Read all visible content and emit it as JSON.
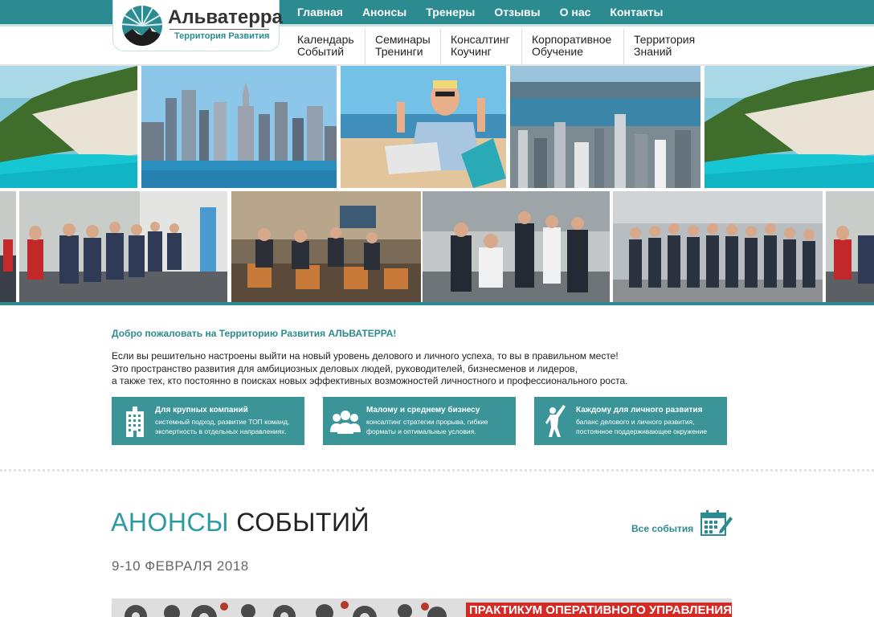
{
  "logo": {
    "title": "Альватерра",
    "subtitle": "Территория Развития"
  },
  "nav": {
    "main": [
      "Главная",
      "Анонсы",
      "Тренеры",
      "Отзывы",
      "О нас",
      "Контакты"
    ],
    "sub": [
      {
        "line1": "Календарь",
        "line2": "Событий"
      },
      {
        "line1": "Семинары",
        "line2": "Тренинги"
      },
      {
        "line1": "Консалтинг",
        "line2": "Коучинг"
      },
      {
        "line1": "Корпоративное",
        "line2": "Обучение"
      },
      {
        "line1": "Территория",
        "line2": "Знаний"
      }
    ]
  },
  "intro": {
    "welcome": "Добро пожаловать на Территорию Развития АЛЬВАТЕРРА!",
    "lines": [
      "Если вы решительно настроены выйти на новый уровень делового и личного успеха, то вы в правильном месте!",
      "Это пространство развития для амбициозных деловых людей, руководителей, бизнесменов и лидеров,",
      "а также тех, кто постоянно в поисках новых эффективных возможностей личностного и профессионального роста."
    ]
  },
  "cards": [
    {
      "icon": "building-icon",
      "title": "Для крупных компаний",
      "line1": "системный подход, развитие ТОП команд,",
      "line2": "экспертность в отдельных направлениях."
    },
    {
      "icon": "group-icon",
      "title": "Малому и среднему бизнесу",
      "line1": "консалтинг стратегии прорыва, гибкие",
      "line2": "форматы и оптимальные условия."
    },
    {
      "icon": "person-raising-hand-icon",
      "title": "Каждому для личного развития",
      "line1": "баланс делового и личного развития,",
      "line2": "постоянное поддерживающее окружение"
    }
  ],
  "events": {
    "title_part1": "АНОНСЫ",
    "title_part2": "СОБЫТИЙ",
    "all_events": "Все события",
    "date": "9-10 ФЕВРАЛЯ 2018",
    "banner_text": "ПРАКТИКУМ ОПЕРАТИВНОГО УПРАВЛЕНИЯ:"
  },
  "colors": {
    "brand": "#2b8b90",
    "card": "#3b9598",
    "accent_red": "#d42a26"
  }
}
